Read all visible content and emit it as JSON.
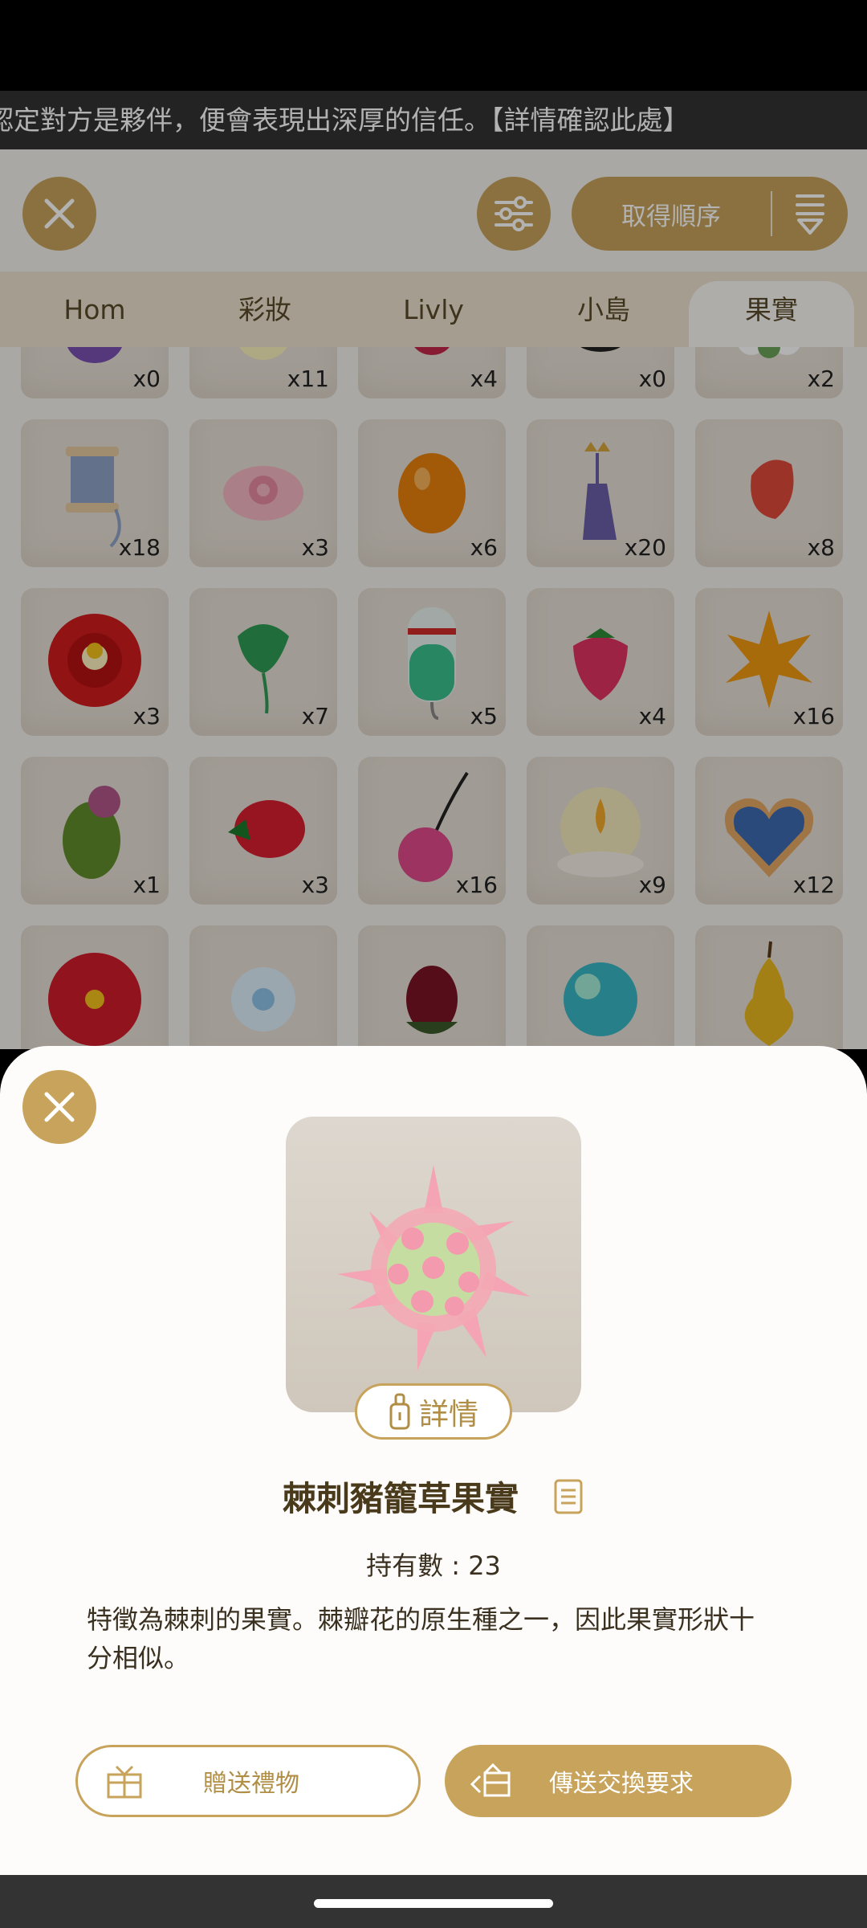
{
  "banner": {
    "text": "認定對方是夥伴，便會表現出深厚的信任。【詳情確認此處】"
  },
  "toolbar": {
    "sort_label": "取得順序"
  },
  "tabs": [
    {
      "label": "Hom"
    },
    {
      "label": "彩妝"
    },
    {
      "label": "Livly"
    },
    {
      "label": "小島"
    },
    {
      "label": "果實",
      "active": true
    }
  ],
  "grid": {
    "items": [
      {
        "name": "purple-egg",
        "count": "x0"
      },
      {
        "name": "glowing-light",
        "count": "x11"
      },
      {
        "name": "red-flower-bud",
        "count": "x4"
      },
      {
        "name": "black-fluff",
        "count": "x0"
      },
      {
        "name": "white-flower",
        "count": "x2"
      },
      {
        "name": "thread-spool",
        "count": "x18"
      },
      {
        "name": "pink-rose",
        "count": "x3"
      },
      {
        "name": "orange-egg",
        "count": "x6"
      },
      {
        "name": "tassel-charm",
        "count": "x20"
      },
      {
        "name": "red-tulip-bud",
        "count": "x8"
      },
      {
        "name": "red-camellia",
        "count": "x3"
      },
      {
        "name": "green-leaf-sprout",
        "count": "x7"
      },
      {
        "name": "green-potion-bottle",
        "count": "x5"
      },
      {
        "name": "strawberry",
        "count": "x4"
      },
      {
        "name": "maple-leaf",
        "count": "x16"
      },
      {
        "name": "poppy-seed-pod",
        "count": "x1"
      },
      {
        "name": "red-strawberry",
        "count": "x3"
      },
      {
        "name": "cherry",
        "count": "x16"
      },
      {
        "name": "candle-light",
        "count": "x9"
      },
      {
        "name": "heart-cookie",
        "count": "x12"
      },
      {
        "name": "red-gerbera",
        "count": ""
      },
      {
        "name": "white-lily",
        "count": ""
      },
      {
        "name": "dark-rose-bud",
        "count": ""
      },
      {
        "name": "blue-bubble",
        "count": ""
      },
      {
        "name": "golden-pear",
        "count": ""
      }
    ]
  },
  "detail": {
    "detail_button_label": "詳情",
    "item_name": "棘刺豬籠草果實",
    "owned_label": "持有數 : 23",
    "description": "特徵為棘刺的果實。棘瓣花的原生種之一，因此果實形狀十分相似。",
    "gift_button_label": "贈送禮物",
    "trade_button_label": "傳送交換要求"
  },
  "colors": {
    "accent_gold": "#c7a35b",
    "text_dark": "#3a3020",
    "tab_bar": "#ece3cf"
  },
  "icons": [
    "close-icon",
    "filter-icon",
    "sort-icon",
    "lock-icon",
    "memo-icon",
    "gift-icon",
    "trade-icon"
  ]
}
